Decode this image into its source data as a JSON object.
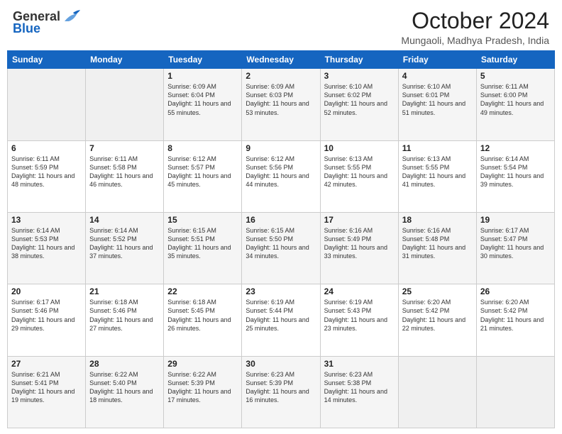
{
  "logo": {
    "general": "General",
    "blue": "Blue"
  },
  "title": "October 2024",
  "location": "Mungaoli, Madhya Pradesh, India",
  "days_of_week": [
    "Sunday",
    "Monday",
    "Tuesday",
    "Wednesday",
    "Thursday",
    "Friday",
    "Saturday"
  ],
  "weeks": [
    [
      {
        "day": "",
        "empty": true
      },
      {
        "day": "",
        "empty": true
      },
      {
        "day": "1",
        "sunrise": "Sunrise: 6:09 AM",
        "sunset": "Sunset: 6:04 PM",
        "daylight": "Daylight: 11 hours and 55 minutes."
      },
      {
        "day": "2",
        "sunrise": "Sunrise: 6:09 AM",
        "sunset": "Sunset: 6:03 PM",
        "daylight": "Daylight: 11 hours and 53 minutes."
      },
      {
        "day": "3",
        "sunrise": "Sunrise: 6:10 AM",
        "sunset": "Sunset: 6:02 PM",
        "daylight": "Daylight: 11 hours and 52 minutes."
      },
      {
        "day": "4",
        "sunrise": "Sunrise: 6:10 AM",
        "sunset": "Sunset: 6:01 PM",
        "daylight": "Daylight: 11 hours and 51 minutes."
      },
      {
        "day": "5",
        "sunrise": "Sunrise: 6:11 AM",
        "sunset": "Sunset: 6:00 PM",
        "daylight": "Daylight: 11 hours and 49 minutes."
      }
    ],
    [
      {
        "day": "6",
        "sunrise": "Sunrise: 6:11 AM",
        "sunset": "Sunset: 5:59 PM",
        "daylight": "Daylight: 11 hours and 48 minutes."
      },
      {
        "day": "7",
        "sunrise": "Sunrise: 6:11 AM",
        "sunset": "Sunset: 5:58 PM",
        "daylight": "Daylight: 11 hours and 46 minutes."
      },
      {
        "day": "8",
        "sunrise": "Sunrise: 6:12 AM",
        "sunset": "Sunset: 5:57 PM",
        "daylight": "Daylight: 11 hours and 45 minutes."
      },
      {
        "day": "9",
        "sunrise": "Sunrise: 6:12 AM",
        "sunset": "Sunset: 5:56 PM",
        "daylight": "Daylight: 11 hours and 44 minutes."
      },
      {
        "day": "10",
        "sunrise": "Sunrise: 6:13 AM",
        "sunset": "Sunset: 5:55 PM",
        "daylight": "Daylight: 11 hours and 42 minutes."
      },
      {
        "day": "11",
        "sunrise": "Sunrise: 6:13 AM",
        "sunset": "Sunset: 5:55 PM",
        "daylight": "Daylight: 11 hours and 41 minutes."
      },
      {
        "day": "12",
        "sunrise": "Sunrise: 6:14 AM",
        "sunset": "Sunset: 5:54 PM",
        "daylight": "Daylight: 11 hours and 39 minutes."
      }
    ],
    [
      {
        "day": "13",
        "sunrise": "Sunrise: 6:14 AM",
        "sunset": "Sunset: 5:53 PM",
        "daylight": "Daylight: 11 hours and 38 minutes."
      },
      {
        "day": "14",
        "sunrise": "Sunrise: 6:14 AM",
        "sunset": "Sunset: 5:52 PM",
        "daylight": "Daylight: 11 hours and 37 minutes."
      },
      {
        "day": "15",
        "sunrise": "Sunrise: 6:15 AM",
        "sunset": "Sunset: 5:51 PM",
        "daylight": "Daylight: 11 hours and 35 minutes."
      },
      {
        "day": "16",
        "sunrise": "Sunrise: 6:15 AM",
        "sunset": "Sunset: 5:50 PM",
        "daylight": "Daylight: 11 hours and 34 minutes."
      },
      {
        "day": "17",
        "sunrise": "Sunrise: 6:16 AM",
        "sunset": "Sunset: 5:49 PM",
        "daylight": "Daylight: 11 hours and 33 minutes."
      },
      {
        "day": "18",
        "sunrise": "Sunrise: 6:16 AM",
        "sunset": "Sunset: 5:48 PM",
        "daylight": "Daylight: 11 hours and 31 minutes."
      },
      {
        "day": "19",
        "sunrise": "Sunrise: 6:17 AM",
        "sunset": "Sunset: 5:47 PM",
        "daylight": "Daylight: 11 hours and 30 minutes."
      }
    ],
    [
      {
        "day": "20",
        "sunrise": "Sunrise: 6:17 AM",
        "sunset": "Sunset: 5:46 PM",
        "daylight": "Daylight: 11 hours and 29 minutes."
      },
      {
        "day": "21",
        "sunrise": "Sunrise: 6:18 AM",
        "sunset": "Sunset: 5:46 PM",
        "daylight": "Daylight: 11 hours and 27 minutes."
      },
      {
        "day": "22",
        "sunrise": "Sunrise: 6:18 AM",
        "sunset": "Sunset: 5:45 PM",
        "daylight": "Daylight: 11 hours and 26 minutes."
      },
      {
        "day": "23",
        "sunrise": "Sunrise: 6:19 AM",
        "sunset": "Sunset: 5:44 PM",
        "daylight": "Daylight: 11 hours and 25 minutes."
      },
      {
        "day": "24",
        "sunrise": "Sunrise: 6:19 AM",
        "sunset": "Sunset: 5:43 PM",
        "daylight": "Daylight: 11 hours and 23 minutes."
      },
      {
        "day": "25",
        "sunrise": "Sunrise: 6:20 AM",
        "sunset": "Sunset: 5:42 PM",
        "daylight": "Daylight: 11 hours and 22 minutes."
      },
      {
        "day": "26",
        "sunrise": "Sunrise: 6:20 AM",
        "sunset": "Sunset: 5:42 PM",
        "daylight": "Daylight: 11 hours and 21 minutes."
      }
    ],
    [
      {
        "day": "27",
        "sunrise": "Sunrise: 6:21 AM",
        "sunset": "Sunset: 5:41 PM",
        "daylight": "Daylight: 11 hours and 19 minutes."
      },
      {
        "day": "28",
        "sunrise": "Sunrise: 6:22 AM",
        "sunset": "Sunset: 5:40 PM",
        "daylight": "Daylight: 11 hours and 18 minutes."
      },
      {
        "day": "29",
        "sunrise": "Sunrise: 6:22 AM",
        "sunset": "Sunset: 5:39 PM",
        "daylight": "Daylight: 11 hours and 17 minutes."
      },
      {
        "day": "30",
        "sunrise": "Sunrise: 6:23 AM",
        "sunset": "Sunset: 5:39 PM",
        "daylight": "Daylight: 11 hours and 16 minutes."
      },
      {
        "day": "31",
        "sunrise": "Sunrise: 6:23 AM",
        "sunset": "Sunset: 5:38 PM",
        "daylight": "Daylight: 11 hours and 14 minutes."
      },
      {
        "day": "",
        "empty": true
      },
      {
        "day": "",
        "empty": true
      }
    ]
  ]
}
